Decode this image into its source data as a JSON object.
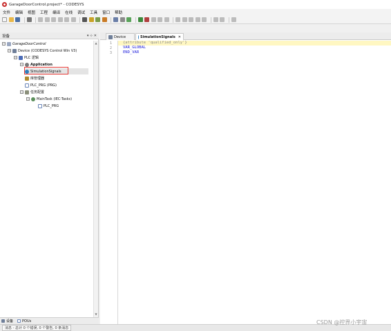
{
  "window": {
    "title": "GarageDoorControl.project* - CODESYS"
  },
  "menu": [
    "文件",
    "编辑",
    "视图",
    "工程",
    "编译",
    "在线",
    "调试",
    "工具",
    "窗口",
    "帮助"
  ],
  "devices_panel": {
    "title": "设备",
    "pin_glyph": "▾ ⊹ ✕",
    "tree": [
      {
        "label": "GarageDoorControl",
        "expander": "−",
        "icon": "project-icon"
      },
      {
        "label": "Device (CODESYS Control Win V3)",
        "expander": "−",
        "icon": "device-icon"
      },
      {
        "label": "PLC 逻辑",
        "expander": "−",
        "icon": "plc-logic-icon"
      },
      {
        "label": "Application",
        "expander": "−",
        "icon": "application-icon"
      },
      {
        "label": "SimulationSignals",
        "expander": "",
        "icon": "gvl-icon"
      },
      {
        "label": "库管理器",
        "expander": "",
        "icon": "library-icon"
      },
      {
        "label": "PLC_PRG (PRG)",
        "expander": "",
        "icon": "pou-icon"
      },
      {
        "label": "任务配置",
        "expander": "−",
        "icon": "task-config-icon"
      },
      {
        "label": "MainTask (IEC-Tasks)",
        "expander": "−",
        "icon": "task-icon"
      },
      {
        "label": "PLC_PRG",
        "expander": "",
        "icon": "call-icon"
      }
    ]
  },
  "bottom_tabs": [
    {
      "label": "设备",
      "icon": "devices-tab-icon"
    },
    {
      "label": "POUs",
      "icon": "pous-tab-icon"
    }
  ],
  "status": {
    "text": "消息 - 总计 0 个错误, 0 个警告, 0 条消息"
  },
  "editor": {
    "tabs": [
      {
        "label": "Device",
        "icon": "device-icon",
        "active": false
      },
      {
        "label": "SimulationSignals",
        "icon": "gvl-icon",
        "active": true,
        "close": "✕"
      }
    ],
    "lines": [
      {
        "num": "1",
        "text": "{attribute 'qualified_only'}"
      },
      {
        "num": "2",
        "text": "VAR_GLOBAL"
      },
      {
        "num": "3",
        "text": "END_VAR"
      }
    ]
  },
  "watermark": "CSDN @控界小宇宙",
  "colors": {
    "pragma": "#8a8a8a",
    "keyword": "#1a1adb",
    "highlight": "#e53935"
  }
}
